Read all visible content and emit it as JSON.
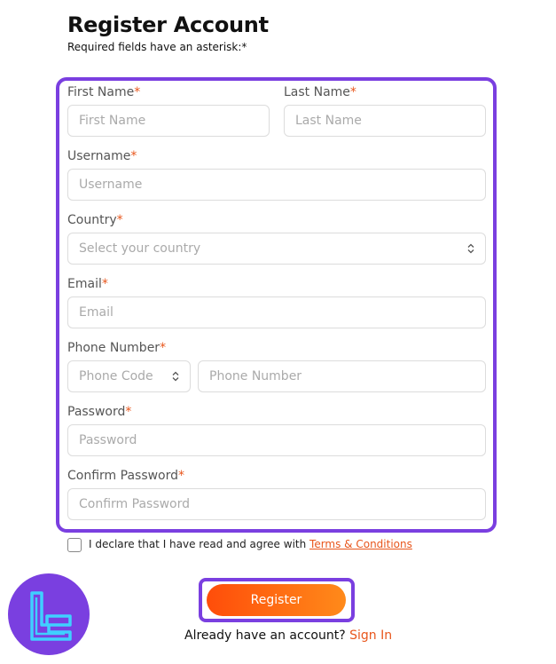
{
  "header": {
    "title": "Register Account",
    "subtitle": "Required fields have an asterisk:*"
  },
  "form": {
    "first_name": {
      "label": "First Name",
      "placeholder": "First Name"
    },
    "last_name": {
      "label": "Last Name",
      "placeholder": "Last Name"
    },
    "username": {
      "label": "Username",
      "placeholder": "Username"
    },
    "country": {
      "label": "Country",
      "placeholder": "Select your country"
    },
    "email": {
      "label": "Email",
      "placeholder": "Email"
    },
    "phone": {
      "label": "Phone Number",
      "code_placeholder": "Phone Code",
      "number_placeholder": "Phone Number"
    },
    "password": {
      "label": "Password",
      "placeholder": "Password"
    },
    "confirm_password": {
      "label": "Confirm Password",
      "placeholder": "Confirm Password"
    },
    "required_marker": "*"
  },
  "agreement": {
    "text": "I declare that I have read and agree with ",
    "terms_link": "Terms & Conditions",
    "checked": false
  },
  "actions": {
    "register_label": "Register",
    "already_text": "Already have an account?",
    "signin_link": "Sign In"
  },
  "colors": {
    "accent_purple": "#7a3fe0",
    "accent_orange": "#e8561c",
    "logo_cyan": "#3fd0ff"
  },
  "icons": {
    "select_chevron": "chevron-up-down-icon",
    "logo": "tradingfinder-logo-icon"
  }
}
